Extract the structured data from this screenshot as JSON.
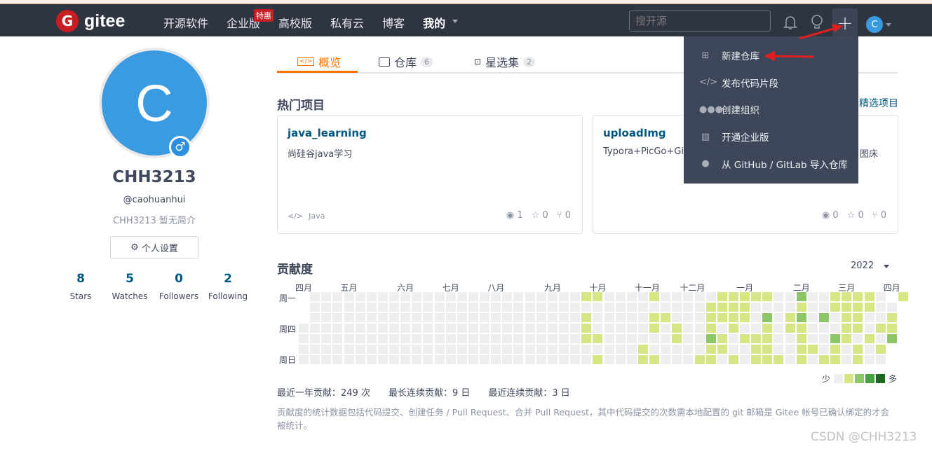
{
  "header": {
    "logo_text": "gitee",
    "nav": [
      "开源软件",
      "企业版",
      "高校版",
      "私有云",
      "博客",
      "我的"
    ],
    "hot_badge": "特惠",
    "search_placeholder": "搜开源",
    "avatar_letter": "C"
  },
  "dropdown": {
    "items": [
      {
        "icon": "plus-square-icon",
        "label": "新建仓库"
      },
      {
        "icon": "code-icon",
        "label": "发布代码片段"
      },
      {
        "icon": "group-icon",
        "label": "创建组织"
      },
      {
        "icon": "building-icon",
        "label": "开通企业版"
      },
      {
        "icon": "github-icon",
        "label": "从 GitHub / GitLab 导入仓库"
      }
    ]
  },
  "profile": {
    "avatar_letter": "C",
    "name": "CHH3213",
    "login": "@caohuanhui",
    "bio": "CHH3213 暂无简介",
    "settings_label": "个人设置",
    "stats": [
      {
        "value": "8",
        "label": "Stars"
      },
      {
        "value": "5",
        "label": "Watches"
      },
      {
        "value": "0",
        "label": "Followers"
      },
      {
        "value": "2",
        "label": "Following"
      }
    ]
  },
  "tabs": [
    {
      "label": "概览",
      "active": true
    },
    {
      "label": "仓库",
      "count": "6"
    },
    {
      "label": "星选集",
      "count": "2"
    }
  ],
  "popular": {
    "title": "热门项目",
    "featured_link": "精选项目",
    "projects": [
      {
        "name": "java_learning",
        "desc": "尚硅谷java学习",
        "lang": "Java",
        "watch": "1",
        "star": "0",
        "fork": "0"
      },
      {
        "name": "uploadImg",
        "desc": "Typora+PicGo+Gitee",
        "desc_tail": "图床",
        "watch": "0",
        "star": "0",
        "fork": "0"
      }
    ]
  },
  "contrib": {
    "title": "贡献度",
    "year": "2022",
    "months": [
      {
        "label": "四月",
        "week": 0
      },
      {
        "label": "五月",
        "week": 4
      },
      {
        "label": "六月",
        "week": 9
      },
      {
        "label": "七月",
        "week": 13
      },
      {
        "label": "八月",
        "week": 17
      },
      {
        "label": "九月",
        "week": 22
      },
      {
        "label": "十月",
        "week": 26
      },
      {
        "label": "十一月",
        "week": 30
      },
      {
        "label": "十二月",
        "week": 34
      },
      {
        "label": "一月",
        "week": 39
      },
      {
        "label": "二月",
        "week": 44
      },
      {
        "label": "三月",
        "week": 48
      },
      {
        "label": "四月",
        "week": 52
      }
    ],
    "weekdays": [
      "周一",
      "周四",
      "周日"
    ],
    "levels_colors": [
      "#eeeeee",
      "#d6e685",
      "#8cc665",
      "#44a340",
      "#1e6823"
    ],
    "rows": [
      "-000000000000000000000000110000100000111110020011110 1",
      "-0000000000000000000000000000000000011110000100111100",
      "-0000000000000000000000001000001100011110201202011001",
      "00000000000000000000000001000001010010100101100011011",
      "00000000000000000000000001100000010021011100100210102",
      "0000000000000000000000000000001000001100110011010101-",
      "0000000000000000000000000010001100011010111010110100-"
    ],
    "legend_less": "少",
    "legend_more": "多",
    "summary": [
      "最近一年贡献：249 次",
      "最长连续贡献：9 日",
      "最近连续贡献：3 日"
    ],
    "note": "贡献度的统计数据包括代码提交、创建任务 / Pull Request、合并 Pull Request，其中代码提交的次数需本地配置的 git 邮箱是 Gitee 帐号已确认绑定的才会被统计。"
  },
  "watermark": "CSDN @CHH3213"
}
